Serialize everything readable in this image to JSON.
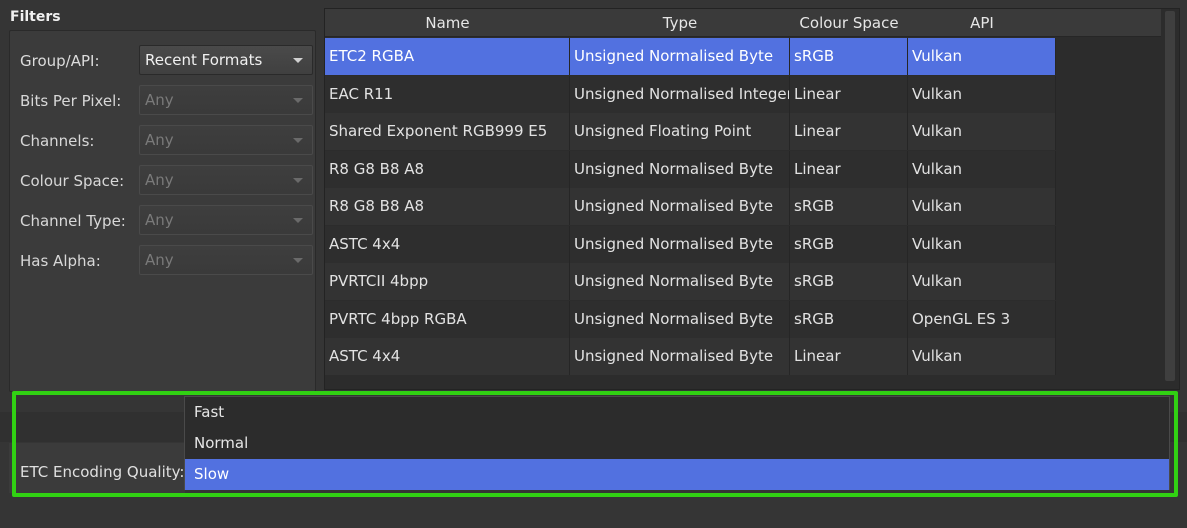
{
  "filters": {
    "title": "Filters",
    "rows": [
      {
        "label": "Group/API:",
        "value": "Recent Formats",
        "enabled": true
      },
      {
        "label": "Bits Per Pixel:",
        "value": "Any",
        "enabled": false
      },
      {
        "label": "Channels:",
        "value": "Any",
        "enabled": false
      },
      {
        "label": "Colour Space:",
        "value": "Any",
        "enabled": false
      },
      {
        "label": "Channel Type:",
        "value": "Any",
        "enabled": false
      },
      {
        "label": "Has Alpha:",
        "value": "Any",
        "enabled": false
      }
    ]
  },
  "table": {
    "columns": [
      "Name",
      "Type",
      "Colour Space",
      "API"
    ],
    "rows": [
      {
        "name": "ETC2 RGBA",
        "type": "Unsigned Normalised Byte",
        "colour_space": "sRGB",
        "api": "Vulkan",
        "selected": true
      },
      {
        "name": "EAC R11",
        "type": "Unsigned Normalised Integer",
        "colour_space": "Linear",
        "api": "Vulkan",
        "selected": false
      },
      {
        "name": "Shared Exponent RGB999 E5",
        "type": "Unsigned Floating Point",
        "colour_space": "Linear",
        "api": "Vulkan",
        "selected": false
      },
      {
        "name": "R8 G8 B8 A8",
        "type": "Unsigned Normalised Byte",
        "colour_space": "Linear",
        "api": "Vulkan",
        "selected": false
      },
      {
        "name": "R8 G8 B8 A8",
        "type": "Unsigned Normalised Byte",
        "colour_space": "sRGB",
        "api": "Vulkan",
        "selected": false
      },
      {
        "name": "ASTC 4x4",
        "type": "Unsigned Normalised Byte",
        "colour_space": "sRGB",
        "api": "Vulkan",
        "selected": false
      },
      {
        "name": "PVRTCII 4bpp",
        "type": "Unsigned Normalised Byte",
        "colour_space": "sRGB",
        "api": "Vulkan",
        "selected": false
      },
      {
        "name": "PVRTC 4bpp RGBA",
        "type": "Unsigned Normalised Byte",
        "colour_space": "sRGB",
        "api": "OpenGL ES 3",
        "selected": false
      },
      {
        "name": "ASTC 4x4",
        "type": "Unsigned Normalised Byte",
        "colour_space": "Linear",
        "api": "Vulkan",
        "selected": false
      }
    ]
  },
  "encoding": {
    "label": "ETC Encoding Quality:",
    "options": [
      {
        "label": "Fast",
        "selected": false
      },
      {
        "label": "Normal",
        "selected": false
      },
      {
        "label": "Slow",
        "selected": true
      }
    ]
  },
  "colors": {
    "selection": "#5271e0",
    "highlight_box": "#31d113",
    "background": "#353535"
  }
}
